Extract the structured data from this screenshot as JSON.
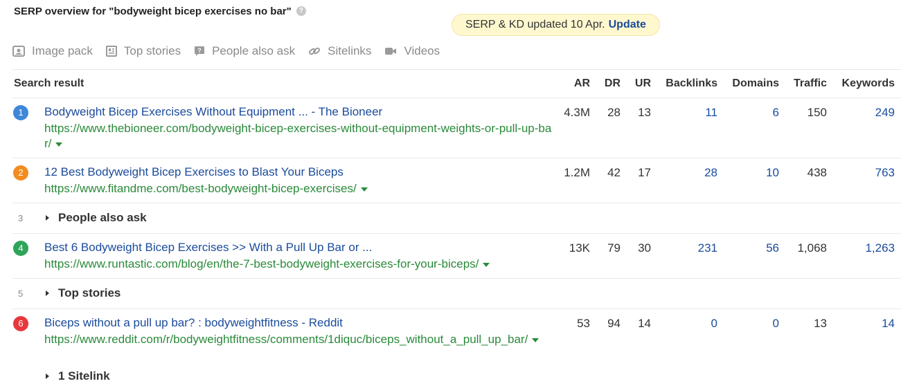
{
  "header": {
    "title": "SERP overview for \"bodyweight bicep exercises no bar\"",
    "help_icon": "?"
  },
  "update_banner": {
    "text": "SERP & KD updated 10 Apr.",
    "link": "Update",
    "background": "#fff8cf"
  },
  "features": [
    {
      "label": "Image pack",
      "icon": "image-icon"
    },
    {
      "label": "Top stories",
      "icon": "newspaper-icon"
    },
    {
      "label": "People also ask",
      "icon": "question-bubble-icon"
    },
    {
      "label": "Sitelinks",
      "icon": "link-icon"
    },
    {
      "label": "Videos",
      "icon": "video-camera-icon"
    }
  ],
  "columns": {
    "result": "Search result",
    "ar": "AR",
    "dr": "DR",
    "ur": "UR",
    "backlinks": "Backlinks",
    "domains": "Domains",
    "traffic": "Traffic",
    "keywords": "Keywords"
  },
  "colors": {
    "link": "#1a4b9c",
    "url": "#2a8a3a",
    "rank1": "#3f87d8",
    "rank2": "#f28c1f",
    "rank4": "#2fa45a",
    "rank6": "#e8383d"
  },
  "results": [
    {
      "rank": "1",
      "title": "Bodyweight Bicep Exercises Without Equipment ... - The Bioneer",
      "url": "https://www.thebioneer.com/bodyweight-bicep-exercises-without-equipment-weights-or-pull-up-bar/",
      "ar": "4.3M",
      "dr": "28",
      "ur": "13",
      "backlinks": "11",
      "domains": "6",
      "traffic": "150",
      "keywords": "249"
    },
    {
      "rank": "2",
      "title": "12 Best Bodyweight Bicep Exercises to Blast Your Biceps",
      "url": "https://www.fitandme.com/best-bodyweight-bicep-exercises/",
      "ar": "1.2M",
      "dr": "42",
      "ur": "17",
      "backlinks": "28",
      "domains": "10",
      "traffic": "438",
      "keywords": "763"
    },
    {
      "rank": "3",
      "label": "People also ask"
    },
    {
      "rank": "4",
      "title": "Best 6 Bodyweight Bicep Exercises >> With a Pull Up Bar or ...",
      "url": "https://www.runtastic.com/blog/en/the-7-best-bodyweight-exercises-for-your-biceps/",
      "ar": "13K",
      "dr": "79",
      "ur": "30",
      "backlinks": "231",
      "domains": "56",
      "traffic": "1,068",
      "keywords": "1,263"
    },
    {
      "rank": "5",
      "label": "Top stories"
    },
    {
      "rank": "6",
      "title": "Biceps without a pull up bar? : bodyweightfitness - Reddit",
      "url": "https://www.reddit.com/r/bodyweightfitness/comments/1diquc/biceps_without_a_pull_up_bar/",
      "ar": "53",
      "dr": "94",
      "ur": "14",
      "backlinks": "0",
      "domains": "0",
      "traffic": "13",
      "keywords": "14",
      "sitelinks": "1 Sitelink"
    }
  ]
}
